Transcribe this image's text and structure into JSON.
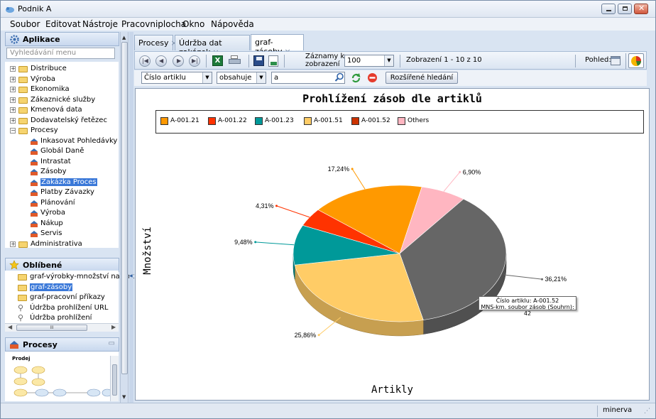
{
  "window": {
    "title": "Podnik A"
  },
  "menu": [
    "Soubor",
    "Editovat",
    "Nástroje",
    "Pracovniplocha",
    "Okno",
    "Nápověda"
  ],
  "apps_panel": {
    "title": "Aplikace",
    "search_placeholder": "Vyhledávání menu",
    "tree": [
      "Distribuce",
      "Výroba",
      "Ekonomika",
      "Zákaznické služby",
      "Kmenová data",
      "Dodavatelský řetězec",
      "Procesy"
    ],
    "processes": [
      "Inkasovat Pohledávky",
      "Globál Daně",
      "Intrastat",
      "Zásoby",
      "Zakázka Proces",
      "Platby Závazky",
      "Plánování",
      "Výroba",
      "Nákup",
      "Servis"
    ],
    "last": "Administrativa"
  },
  "favorites": {
    "title": "Oblíbené",
    "items": [
      "graf-výrobky-množství na zak",
      "graf-zásoby",
      "graf-pracovní příkazy",
      "Údržba prohlížení URL",
      "Údržba prohlížení"
    ],
    "scroll_glyph": "III"
  },
  "process_panel": {
    "title": "Procesy",
    "diagram_label": "Prodej"
  },
  "tabs": [
    "Procesy",
    "Údržba dat zakázek",
    "graf-zásoby"
  ],
  "toolbar": {
    "records_label_1": "Záznamy k",
    "records_label_2": "zobrazení",
    "records_value": "100",
    "display_info": "Zobrazení 1 - 10 z 10",
    "view_label": "Pohled:"
  },
  "filter": {
    "field": "Číslo artiklu",
    "operator": "obsahuje",
    "value": "a",
    "advanced": "Rozšířené hledání"
  },
  "chart_data": {
    "type": "pie",
    "title": "Prohlížení zásob dle artiklů",
    "xlabel": "Artikly",
    "ylabel": "Množství",
    "legend_position": "top",
    "legend": [
      {
        "name": "A-001.21",
        "color": "#ff9900"
      },
      {
        "name": "A-001.22",
        "color": "#ff3300"
      },
      {
        "name": "A-001.23",
        "color": "#009999"
      },
      {
        "name": "A-001.51",
        "color": "#ffcc66"
      },
      {
        "name": "A-001.52",
        "color": "#cc3300"
      },
      {
        "name": "Others",
        "color": "#ffb6c1"
      }
    ],
    "slices": [
      {
        "label": "6,90%",
        "value": 6.9,
        "color": "#ffb6c1"
      },
      {
        "label": "36,21%",
        "value": 36.21,
        "color": "#666666"
      },
      {
        "label": "25,86%",
        "value": 25.86,
        "color": "#ffcc66"
      },
      {
        "label": "9,48%",
        "value": 9.48,
        "color": "#009999"
      },
      {
        "label": "4,31%",
        "value": 4.31,
        "color": "#ff3300"
      },
      {
        "label": "17,24%",
        "value": 17.24,
        "color": "#ff9900"
      }
    ],
    "tooltip": [
      "Číslo artiklu: A-001.52",
      "MNS-km. soubor zásob (Souhrn): 42"
    ]
  },
  "status": {
    "user": "minerva"
  }
}
